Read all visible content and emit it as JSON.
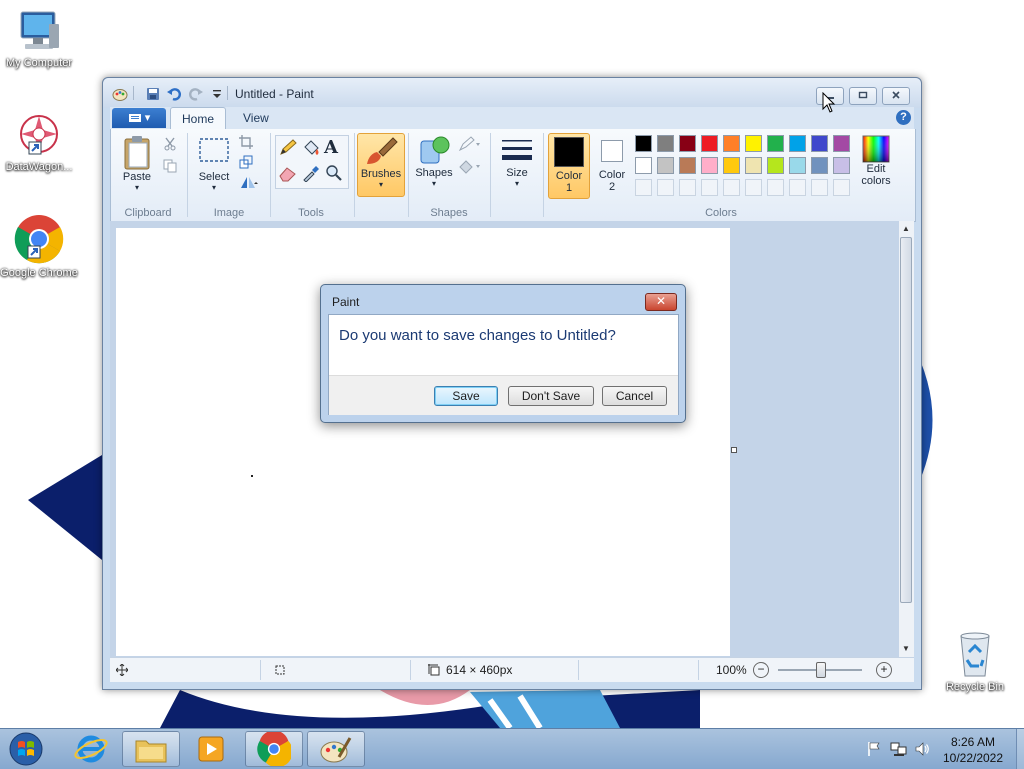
{
  "desktop": {
    "icons": [
      {
        "label": "My Computer"
      },
      {
        "label": "DataWagon..."
      },
      {
        "label": "Google Chrome"
      },
      {
        "label": "Recycle Bin"
      }
    ]
  },
  "window": {
    "title": "Untitled - Paint",
    "menu": {
      "file_button": "▾"
    },
    "tabs": [
      {
        "label": "Home"
      },
      {
        "label": "View"
      }
    ],
    "help_icon": "?",
    "ribbon": {
      "clipboard": {
        "paste": "Paste",
        "group": "Clipboard"
      },
      "image": {
        "select": "Select",
        "group": "Image"
      },
      "tools": {
        "group": "Tools",
        "text_tool": "A"
      },
      "brushes": {
        "label": "Brushes"
      },
      "shapes": {
        "label": "Shapes",
        "group": "Shapes"
      },
      "size": {
        "label": "Size"
      },
      "color1": {
        "label_line1": "Color",
        "label_line2": "1",
        "value": "#000000"
      },
      "color2": {
        "label_line1": "Color",
        "label_line2": "2",
        "value": "#ffffff"
      },
      "colors": {
        "group": "Colors",
        "palette_row1": [
          "#000000",
          "#7f7f7f",
          "#880015",
          "#ed1c24",
          "#ff7f27",
          "#fff200",
          "#22b14c",
          "#00a2e8",
          "#3f48cc",
          "#a349a4"
        ],
        "palette_row2": [
          "#ffffff",
          "#c3c3c3",
          "#b97a57",
          "#ffaec9",
          "#ffc90e",
          "#efe4b0",
          "#b5e61d",
          "#99d9ea",
          "#7092be",
          "#c8bfe7"
        ],
        "edit_colors_line1": "Edit",
        "edit_colors_line2": "colors"
      }
    },
    "statusbar": {
      "canvas_size": "614 × 460px",
      "zoom": "100%"
    }
  },
  "dialog": {
    "title": "Paint",
    "close": "✕",
    "message": "Do you want to save changes to Untitled?",
    "buttons": {
      "save": "Save",
      "dont_save": "Don't Save",
      "cancel": "Cancel"
    }
  },
  "taskbar": {
    "time": "8:26 AM",
    "date": "10/22/2022"
  }
}
